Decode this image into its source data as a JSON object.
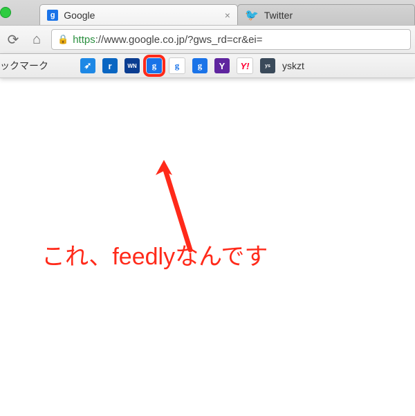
{
  "tabs": [
    {
      "title": "Google",
      "favicon_letter": "g",
      "active": true
    },
    {
      "title": "Twitter",
      "favicon_glyph": "🐦",
      "active": false
    }
  ],
  "toolbar": {
    "reload_glyph": "⟳",
    "home_glyph": "⌂",
    "lock_glyph": "🔒",
    "url_scheme": "https",
    "url_rest": "://www.google.co.jp/?gws_rd=cr&ei="
  },
  "bookmarks": {
    "folder_label": "ックマーク",
    "items": [
      {
        "name": "dolphin",
        "letter": "➶",
        "cls": "bm1"
      },
      {
        "name": "r",
        "letter": "r",
        "cls": "bm2"
      },
      {
        "name": "wn",
        "letter": "WN",
        "cls": "bm3"
      },
      {
        "name": "google-1",
        "letter": "g",
        "cls": "bmG",
        "highlight": true
      },
      {
        "name": "google-2",
        "letter": "g",
        "cls": "bmGw"
      },
      {
        "name": "google-3",
        "letter": "g",
        "cls": "bmG"
      },
      {
        "name": "yahoo-purple",
        "letter": "Y",
        "cls": "bmY"
      },
      {
        "name": "yahoo-jp",
        "letter": "Y!",
        "cls": "bmYj"
      },
      {
        "name": "yskzt-icon",
        "letter": "ys",
        "cls": "bmS"
      }
    ],
    "text_item": "yskzt"
  },
  "annotation": {
    "text": "これ、feedlyなんです",
    "arrow_color": "#ff2a1a"
  }
}
